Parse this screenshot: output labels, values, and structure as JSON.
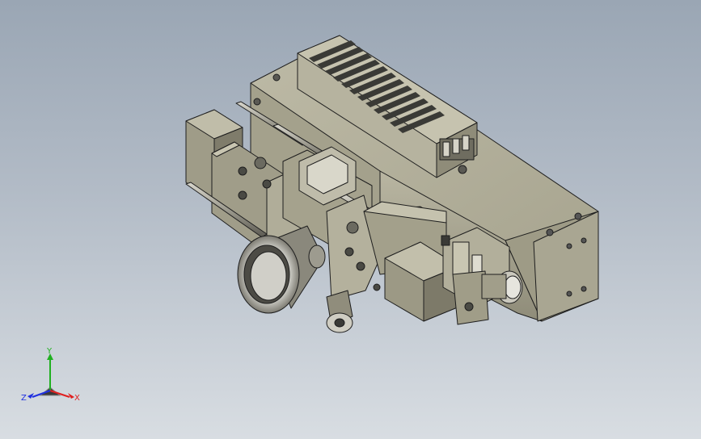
{
  "app": {
    "kind": "cad-3d-viewport"
  },
  "colors": {
    "background_top": "#9aa6b4",
    "background_bottom": "#d8dde2",
    "body_light": "#c3c0ad",
    "body_mid": "#a9a690",
    "body_dark": "#7f7c6b",
    "edge": "#1e1e1e",
    "axis_x": "#e02020",
    "axis_y": "#20b020",
    "axis_z": "#2030e0"
  },
  "triad": {
    "x_label": "X",
    "y_label": "Y",
    "z_label": "Z",
    "icon": "orientation-triad-icon"
  }
}
